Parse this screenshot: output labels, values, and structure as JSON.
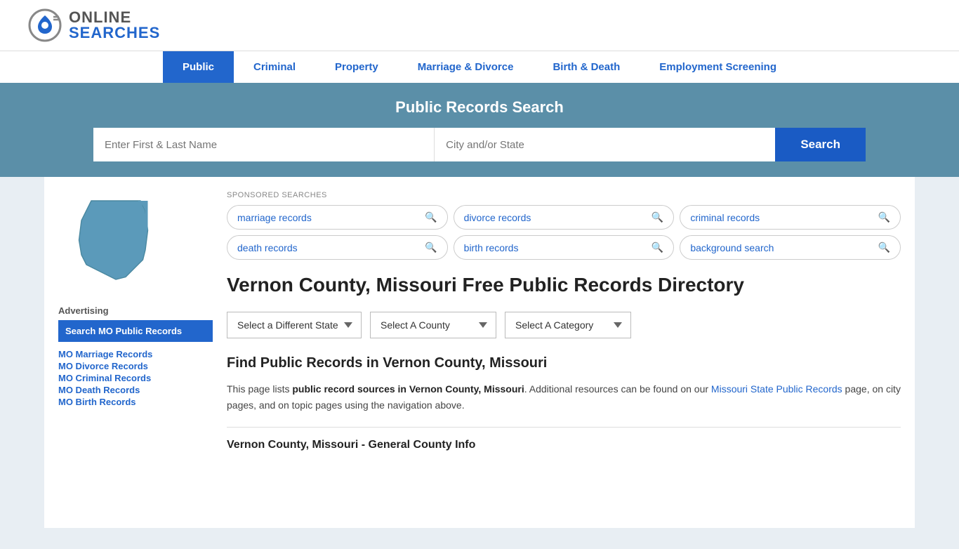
{
  "logo": {
    "online": "ONLINE",
    "searches": "SEARCHES"
  },
  "nav": {
    "items": [
      {
        "label": "Public",
        "active": true
      },
      {
        "label": "Criminal",
        "active": false
      },
      {
        "label": "Property",
        "active": false
      },
      {
        "label": "Marriage & Divorce",
        "active": false
      },
      {
        "label": "Birth & Death",
        "active": false
      },
      {
        "label": "Employment Screening",
        "active": false
      }
    ]
  },
  "search_banner": {
    "title": "Public Records Search",
    "name_placeholder": "Enter First & Last Name",
    "location_placeholder": "City and/or State",
    "button_label": "Search"
  },
  "sponsored": {
    "label": "SPONSORED SEARCHES",
    "tags": [
      {
        "text": "marriage records"
      },
      {
        "text": "divorce records"
      },
      {
        "text": "criminal records"
      },
      {
        "text": "death records"
      },
      {
        "text": "birth records"
      },
      {
        "text": "background search"
      }
    ]
  },
  "page": {
    "heading": "Vernon County, Missouri Free Public Records Directory",
    "dropdowns": {
      "state": "Select a Different State",
      "county": "Select A County",
      "category": "Select A Category"
    },
    "find_heading": "Find Public Records in Vernon County, Missouri",
    "description_part1": "This page lists ",
    "description_bold": "public record sources in Vernon County, Missouri",
    "description_part2": ". Additional resources can be found on our ",
    "description_link_text": "Missouri State Public Records",
    "description_part3": " page, on city pages, and on topic pages using the navigation above.",
    "sub_heading": "Vernon County, Missouri - General County Info"
  },
  "sidebar": {
    "advertising_label": "Advertising",
    "ad_block_text": "Search MO Public Records",
    "links": [
      {
        "text": "MO Marriage Records"
      },
      {
        "text": "MO Divorce Records"
      },
      {
        "text": "MO Criminal Records"
      },
      {
        "text": "MO Death Records"
      },
      {
        "text": "MO Birth Records"
      }
    ]
  }
}
